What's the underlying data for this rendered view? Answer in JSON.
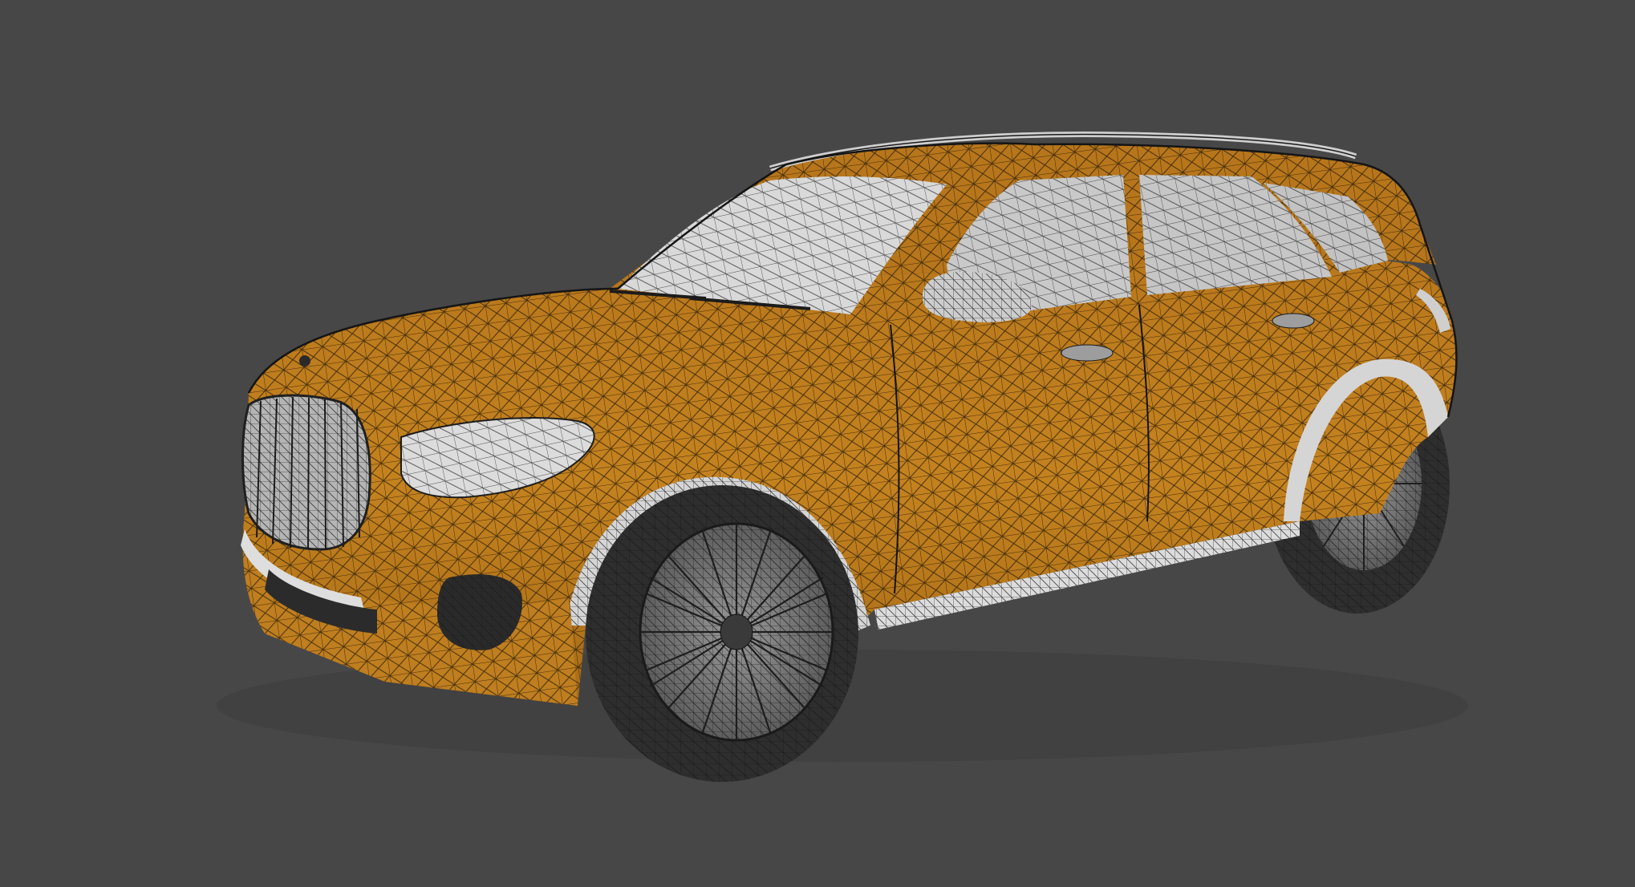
{
  "viewport": {
    "caption": "",
    "background_color": "#474747"
  },
  "model": {
    "subject": "suv-car-wireframe-model",
    "body_color": "#c17f1f",
    "glass_color": "#d9d9d9",
    "trim_color": "#dcdcdc",
    "tire_color": "#2e2e2e",
    "wire_color": "#141414"
  }
}
